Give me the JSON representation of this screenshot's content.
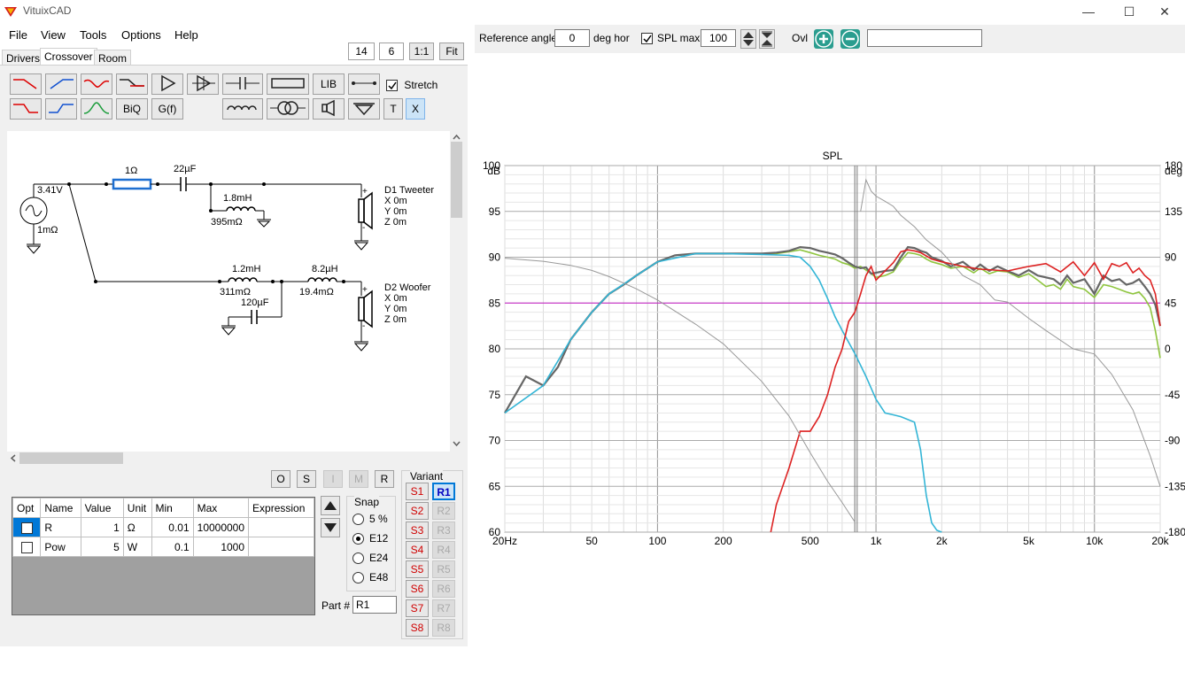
{
  "app": {
    "title": "VituixCAD"
  },
  "window_controls": {
    "minimize": "—",
    "maximize": "☐",
    "close": "✕"
  },
  "menu": [
    "File",
    "View",
    "Tools",
    "Options",
    "Help"
  ],
  "tabs": [
    "Drivers",
    "Crossover",
    "Room"
  ],
  "zoom": {
    "value1": "14",
    "value2": "6",
    "one_to_one": "1:1",
    "fit": "Fit"
  },
  "toolbar": {
    "biq": "BiQ",
    "gf": "G(f)",
    "lib": "LIB",
    "t": "T",
    "x": "X",
    "stretch_label": "Stretch"
  },
  "schematic": {
    "source_voltage": "3.41V",
    "source_resistance": "1mΩ",
    "r1_value": "1Ω",
    "c1_value": "22µF",
    "l1_value": "1.8mH",
    "l1_resistance": "395mΩ",
    "l2_value": "1.2mH",
    "l2_resistance": "311mΩ",
    "l3_value": "8.2µH",
    "l3_resistance": "19.4mΩ",
    "c2_value": "120µF",
    "d1": {
      "name": "D1 Tweeter",
      "x": "X 0m",
      "y": "Y 0m",
      "z": "Z 0m"
    },
    "d2": {
      "name": "D2 Woofer",
      "x": "X 0m",
      "y": "Y 0m",
      "z": "Z 0m"
    }
  },
  "mini_buttons": [
    "O",
    "S",
    "I",
    "M",
    "R"
  ],
  "grid": {
    "headers": [
      "Opt",
      "Name",
      "Value",
      "Unit",
      "Min",
      "Max",
      "Expression"
    ],
    "rows": [
      {
        "name": "R",
        "value": "1",
        "unit": "Ω",
        "min": "0.01",
        "max": "10000000",
        "expression": ""
      },
      {
        "name": "Pow",
        "value": "5",
        "unit": "W",
        "min": "0.1",
        "max": "1000",
        "expression": ""
      }
    ]
  },
  "snap": {
    "title": "Snap",
    "options": [
      "5 %",
      "E12",
      "E24",
      "E48"
    ],
    "selected": "E12"
  },
  "part": {
    "label": "Part #",
    "value": "R1"
  },
  "variant": {
    "title": "Variant",
    "s": [
      "S1",
      "S2",
      "S3",
      "S4",
      "S5",
      "S6",
      "S7",
      "S8"
    ],
    "r": [
      "R1",
      "R2",
      "R3",
      "R4",
      "R5",
      "R6",
      "R7",
      "R8"
    ],
    "selected": "R1"
  },
  "right_toolbar": {
    "ref_angle_label": "Reference angle",
    "ref_angle_value": "0",
    "ref_angle_unit": "deg hor",
    "spl_max_label": "SPL max",
    "spl_max_value": "100",
    "ovl_label": "Ovl",
    "ovl_input": ""
  },
  "colors": {
    "total_measured": "#666666",
    "total_sim": "#8fc53f",
    "tweeter": "#dd2222",
    "woofer": "#33b5d6",
    "dark_red": "#a02020",
    "teal": "#2f7d8a",
    "phase": "#999999",
    "ref85": "#cc22cc"
  },
  "chart_data": {
    "type": "line",
    "title": "SPL",
    "y_unit_left": "dB",
    "y_unit_right": "deg",
    "x_log": true,
    "xlim": [
      20,
      20000
    ],
    "ylim": [
      60,
      100
    ],
    "y2lim": [
      -180,
      180
    ],
    "x_ticks": [
      20,
      50,
      100,
      200,
      500,
      1000,
      2000,
      5000,
      10000,
      20000
    ],
    "x_tick_labels": [
      "20Hz",
      "50",
      "100",
      "200",
      "500",
      "1k",
      "2k",
      "5k",
      "10k",
      "20k"
    ],
    "y_ticks": [
      60,
      65,
      70,
      75,
      80,
      85,
      90,
      95,
      100
    ],
    "y2_ticks": [
      -180,
      -135,
      -90,
      -45,
      0,
      45,
      90,
      135,
      180
    ],
    "grid": true,
    "markers_x": [
      800,
      820
    ],
    "reference_line_y": 85,
    "series": [
      {
        "color_key": "total_sim",
        "x": [
          20,
          25,
          30,
          35,
          40,
          50,
          60,
          70,
          80,
          100,
          120,
          150,
          200,
          250,
          300,
          350,
          400,
          450,
          500,
          550,
          600,
          650,
          700,
          750,
          800,
          850,
          900,
          950,
          1000,
          1100,
          1200,
          1300,
          1400,
          1500,
          1600,
          1700,
          1800,
          2000,
          2200,
          2500,
          2800,
          3000,
          3300,
          3600,
          4000,
          4500,
          5000,
          5500,
          6000,
          6500,
          7000,
          7500,
          8000,
          9000,
          10000,
          11000,
          12000,
          13000,
          14000,
          15000,
          16000,
          17000,
          18000,
          19000,
          20000
        ],
        "y": [
          73,
          77,
          76,
          78,
          81,
          84,
          86,
          87,
          88,
          89.5,
          90.2,
          90.4,
          90.4,
          90.4,
          90.4,
          90.4,
          90.6,
          90.8,
          90.5,
          90.2,
          90,
          89.8,
          89.4,
          89.2,
          88.8,
          89,
          88.6,
          88.2,
          87.8,
          88,
          88.4,
          89.6,
          90.5,
          90.4,
          90.2,
          89.8,
          89.5,
          89.2,
          88.8,
          89,
          88.3,
          88.8,
          88.2,
          88.5,
          88.4,
          87.8,
          88.2,
          87.5,
          86.8,
          87,
          86.5,
          87.6,
          86.8,
          86.5,
          85.6,
          87,
          86.8,
          86.5,
          86.2,
          86,
          86.2,
          85.5,
          84.5,
          82,
          79
        ]
      },
      {
        "color_key": "total_measured",
        "x": [
          20,
          25,
          30,
          35,
          40,
          50,
          60,
          70,
          80,
          100,
          120,
          150,
          200,
          250,
          300,
          350,
          400,
          450,
          500,
          550,
          600,
          650,
          700,
          750,
          800,
          850,
          900,
          950,
          1000,
          1100,
          1200,
          1300,
          1400,
          1500,
          1600,
          1700,
          1800,
          2000,
          2200,
          2500,
          2800,
          3000,
          3300,
          3600,
          4000,
          4500,
          5000,
          5500,
          6000,
          6500,
          7000,
          7500,
          8000,
          9000,
          10000,
          11000,
          12000,
          13000,
          14000,
          15000,
          16000,
          17000,
          18000,
          19000,
          20000
        ],
        "y": [
          73,
          77,
          76,
          78,
          81,
          84,
          86,
          87,
          88,
          89.5,
          90.2,
          90.4,
          90.4,
          90.4,
          90.4,
          90.5,
          90.7,
          91.1,
          91,
          90.7,
          90.5,
          90.3,
          89.9,
          89.4,
          89,
          88.8,
          88.9,
          88.2,
          88.3,
          88.5,
          88.6,
          90,
          91.1,
          91,
          90.7,
          90.5,
          90,
          89.6,
          89,
          89.5,
          88.6,
          89.2,
          88.5,
          89,
          88.5,
          88,
          88.6,
          88,
          87.8,
          87.6,
          87,
          88,
          87.2,
          87.6,
          86,
          88,
          87.4,
          87.6,
          87,
          87.2,
          87.6,
          86.8,
          86,
          84.8,
          82.5
        ]
      },
      {
        "color_key": "woofer",
        "x": [
          20,
          30,
          40,
          50,
          60,
          80,
          100,
          150,
          200,
          300,
          400,
          450,
          500,
          550,
          600,
          650,
          700,
          800,
          900,
          1000,
          1100,
          1200,
          1300,
          1500,
          1600,
          1700,
          1800,
          1900,
          2000
        ],
        "y": [
          73,
          76,
          81,
          84,
          86,
          88,
          89.5,
          90.4,
          90.4,
          90.3,
          90.2,
          90,
          89,
          87.5,
          85.5,
          83.5,
          82,
          79.5,
          77,
          74.5,
          73,
          72.8,
          72.6,
          72,
          69,
          64,
          61,
          60.2,
          60
        ]
      },
      {
        "color_key": "tweeter",
        "x": [
          330,
          350,
          400,
          450,
          500,
          550,
          600,
          650,
          700,
          750,
          800,
          850,
          900,
          950,
          1000,
          1100,
          1200,
          1300,
          1400,
          1500,
          1600,
          1800,
          2000,
          2500,
          3000,
          4000,
          5000,
          6000,
          7000,
          8000,
          9000,
          10000,
          11000,
          12000,
          13000,
          14000,
          15000,
          16000,
          17000,
          18000,
          19000,
          20000
        ],
        "y": [
          60,
          63,
          67,
          71,
          71,
          72.6,
          75,
          78,
          80,
          83,
          84,
          86,
          88,
          89,
          87.5,
          88.5,
          89.4,
          90.6,
          90.8,
          90.7,
          90.5,
          89.8,
          89.5,
          89,
          88.7,
          88.5,
          89,
          89.3,
          88.4,
          89.5,
          88,
          89.4,
          87.6,
          89.3,
          89,
          89.4,
          88.3,
          88.8,
          88,
          87.5,
          86,
          82.5
        ]
      },
      {
        "color_key": "phase",
        "axis": "right",
        "x": [
          20,
          30,
          40,
          50,
          60,
          80,
          100,
          150,
          200,
          300,
          400,
          500,
          600,
          700,
          800,
          850,
          900,
          950,
          1000,
          1100,
          1200,
          1300,
          1500,
          1700,
          2000,
          2500,
          3000,
          3500,
          4000,
          5000,
          6000,
          8000,
          10000,
          12000,
          15000,
          18000,
          20000
        ],
        "y": [
          89,
          86,
          82,
          77,
          71,
          59,
          48,
          24,
          5,
          -32,
          -66,
          -102,
          -130,
          -151,
          -170,
          135,
          166,
          155,
          150,
          145,
          140,
          131,
          120,
          107,
          95,
          72,
          63,
          48,
          46,
          30,
          18,
          0,
          -5,
          -25,
          -60,
          -105,
          -135
        ]
      }
    ]
  }
}
